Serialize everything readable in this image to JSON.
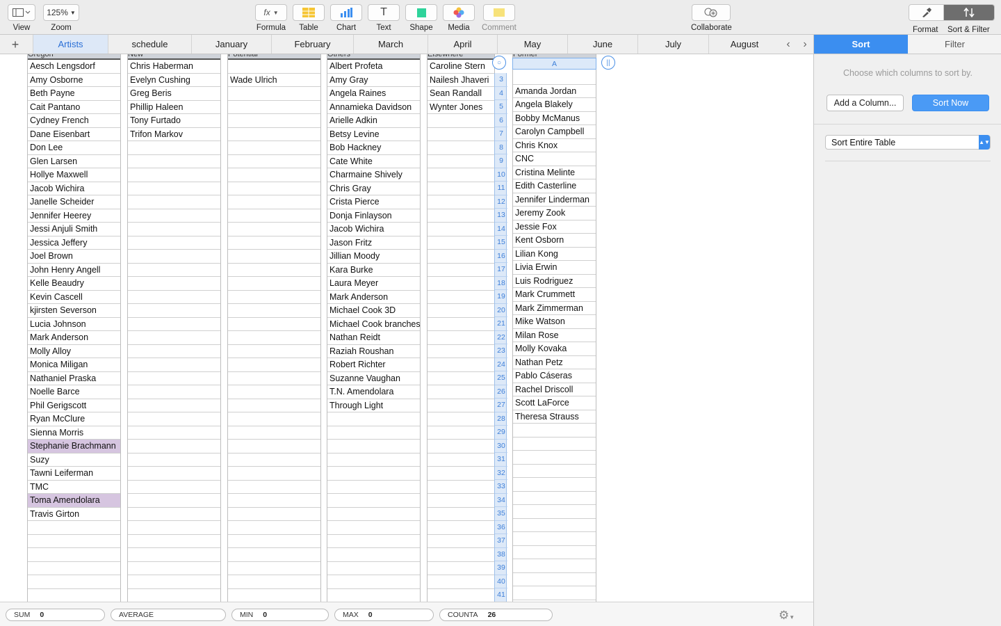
{
  "toolbar": {
    "view_label": "View",
    "zoom_value": "125%",
    "zoom_label": "Zoom",
    "formula_label": "Formula",
    "table_label": "Table",
    "chart_label": "Chart",
    "text_label": "Text",
    "shape_label": "Shape",
    "media_label": "Media",
    "comment_label": "Comment",
    "collaborate_label": "Collaborate",
    "format_label": "Format",
    "sortfilter_label": "Sort & Filter",
    "fx_glyph": "fx",
    "text_glyph": "T"
  },
  "tabs": [
    {
      "label": "Artists",
      "active": true
    },
    {
      "label": "schedule",
      "active": false
    },
    {
      "label": "January",
      "active": false
    },
    {
      "label": "February",
      "active": false
    },
    {
      "label": "March",
      "active": false
    },
    {
      "label": "April",
      "active": false
    },
    {
      "label": "May",
      "active": false
    },
    {
      "label": "June",
      "active": false
    },
    {
      "label": "July",
      "active": false
    },
    {
      "label": "August",
      "active": false
    }
  ],
  "columns": [
    {
      "header": "Oregon",
      "cells": [
        "Aesch Lengsdorf",
        "Amy Osborne",
        "Beth Payne",
        "Cait Pantano",
        "Cydney French",
        "Dane Eisenbart",
        "Don Lee",
        "Glen Larsen",
        "Hollye Maxwell",
        "Jacob Wichira",
        "Janelle Scheider",
        "Jennifer Heerey",
        "Jessi Anjuli Smith",
        "Jessica Jeffery",
        "Joel Brown",
        "John Henry Angell",
        "Kelle Beaudry",
        "Kevin Cascell",
        "kjirsten Severson",
        "Lucia Johnson",
        "Mark Anderson",
        "Molly Alloy",
        "Monica Miligan",
        "Nathaniel Praska",
        "Noelle Barce",
        "Phil Gerigscott",
        "Ryan McClure",
        "Sienna Morris",
        "Stephanie Brachmann",
        "Suzy",
        "Tawni Leiferman",
        "TMC",
        "Toma Amendolara",
        "Travis Girton"
      ],
      "highlight": [
        28,
        32
      ]
    },
    {
      "header": "New",
      "cells": [
        "Chris Haberman",
        "Evelyn Cushing",
        "Greg Beris",
        "Phillip  Haleen",
        "Tony Furtado",
        "Trifon Markov"
      ],
      "highlight": []
    },
    {
      "header": "Potential",
      "cells": [
        "",
        "Wade Ulrich"
      ],
      "highlight": []
    },
    {
      "header": "Others",
      "cells": [
        "Albert Profeta",
        "Amy Gray",
        "Angela Raines",
        "Annamieka Davidson",
        "Arielle Adkin",
        "Betsy Levine",
        "Bob Hackney",
        "Cate White",
        "Charmaine Shively",
        "Chris Gray",
        "Crista Pierce",
        "Donja Finlayson",
        "Jacob Wichira",
        "Jason Fritz",
        "Jillian Moody",
        "Kara Burke",
        "Laura Meyer",
        "Mark Anderson",
        "Michael Cook 3D",
        "Michael Cook branches",
        "Nathan Reidt",
        "Raziah Roushan",
        "Robert Richter",
        "Suzanne Vaughan",
        "T.N. Amendolara",
        "Through Light"
      ],
      "highlight": []
    },
    {
      "header": "Elsewhere",
      "cells": [
        "Caroline Stern",
        "Nailesh Jhaveri",
        "Sean Randall",
        "Wynter Jones"
      ],
      "highlight": []
    },
    {
      "header": "Former",
      "cells": [
        "",
        "Amanda Jordan",
        "Angela Blakely",
        "Bobby McManus",
        "Carolyn Campbell",
        "Chris Knox",
        "CNC",
        "Cristina Melinte",
        "Edith Casterline",
        "Jennifer Linderman",
        "Jeremy Zook",
        "Jessie Fox",
        "Kent Osborn",
        "Lilian Kong",
        "Livia Erwin",
        "Luis Rodriguez",
        "Mark Crummett",
        "Mark Zimmerman",
        "Mike Watson",
        "Milan Rose",
        "Molly Kovaka",
        "Nathan Petz",
        "Pablo Cáseras",
        "Rachel Driscoll",
        "Scott LaForce",
        "Theresa Strauss"
      ],
      "highlight": []
    }
  ],
  "row_numbers": [
    "3",
    "4",
    "5",
    "6",
    "7",
    "8",
    "9",
    "10",
    "11",
    "12",
    "13",
    "14",
    "15",
    "16",
    "17",
    "18",
    "19",
    "20",
    "21",
    "22",
    "23",
    "24",
    "25",
    "26",
    "27",
    "28",
    "29",
    "30",
    "31",
    "32",
    "33",
    "34",
    "35",
    "36",
    "37",
    "38",
    "39",
    "40",
    "41"
  ],
  "column_a_label": "A",
  "panel": {
    "tab_sort": "Sort",
    "tab_filter": "Filter",
    "hint": "Choose which columns to sort by.",
    "add_column": "Add a Column...",
    "sort_now": "Sort Now",
    "sort_scope": "Sort Entire Table"
  },
  "status": {
    "sum_label": "SUM",
    "sum_value": "0",
    "avg_label": "AVERAGE",
    "avg_value": "",
    "min_label": "MIN",
    "min_value": "0",
    "max_label": "MAX",
    "max_value": "0",
    "counta_label": "COUNTA",
    "counta_value": "26"
  },
  "colors": {
    "accent": "#3b8ef0",
    "highlight_cell": "#d6c5e0"
  }
}
